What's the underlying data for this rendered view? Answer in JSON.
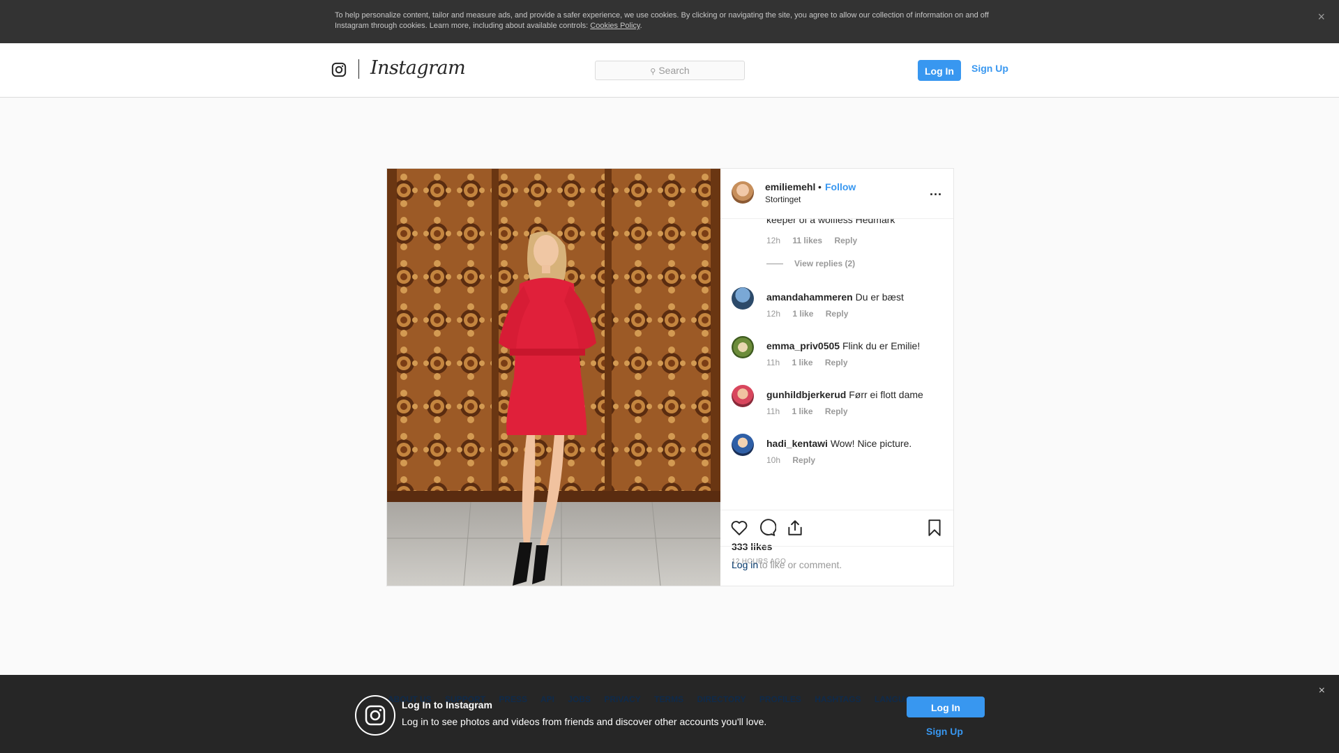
{
  "cookie_banner": {
    "text": "To help personalize content, tailor and measure ads, and provide a safer experience, we use cookies. By clicking or navigating the site, you agree to allow our collection of information on and off Instagram through cookies. Learn more, including about available controls: ",
    "link": "Cookies Policy",
    "suffix": ".",
    "close": "×"
  },
  "header": {
    "logo_word": "Instagram",
    "search_placeholder": "Search",
    "login": "Log In",
    "signup": "Sign Up"
  },
  "post": {
    "owner": "emiliemehl",
    "separator": "•",
    "follow": "Follow",
    "location": "Stortinget",
    "more": "...",
    "cut_comment": "keeper of a wolfless Hedmark",
    "cut_meta": {
      "time": "12h",
      "likes": "11 likes",
      "reply": "Reply"
    },
    "view_replies": "View replies (2)",
    "comments": [
      {
        "user": "amandahammeren",
        "text": "Du er bæst ",
        "time": "12h",
        "likes": "1 like",
        "reply": "Reply"
      },
      {
        "user": "emma_priv0505",
        "text": "Flink du er Emilie!",
        "time": "11h",
        "likes": "1 like",
        "reply": "Reply"
      },
      {
        "user": "gunhildbjerkerud",
        "text": "Førr ei flott dame",
        "time": "11h",
        "likes": "1 like",
        "reply": "Reply"
      },
      {
        "user": "hadi_kentawi",
        "text": "Wow! Nice picture.",
        "time": "10h",
        "likes": "",
        "reply": "Reply"
      }
    ],
    "likes": "333 likes",
    "posted": "12 HOURS AGO",
    "login_link": "Log in",
    "login_rest": "to like or comment."
  },
  "footer": {
    "links": [
      "ABOUT US",
      "SUPPORT",
      "PRESS",
      "API",
      "JOBS",
      "PRIVACY",
      "TERMS",
      "DIRECTORY",
      "PROFILES",
      "HASHTAGS",
      "LANGUAGE"
    ],
    "title": "Log In to Instagram",
    "desc": "Log in to see photos and videos from friends and discover other accounts you'll love.",
    "login": "Log In",
    "signup": "Sign Up",
    "close": "×"
  },
  "colors": {
    "accent": "#3897f0",
    "cookie_bg": "#333333",
    "footer_bg": "#262626"
  },
  "icons": [
    "instagram-glyph-icon",
    "search-icon",
    "more-icon",
    "heart-icon",
    "comment-icon",
    "share-icon",
    "bookmark-icon",
    "close-icon"
  ]
}
